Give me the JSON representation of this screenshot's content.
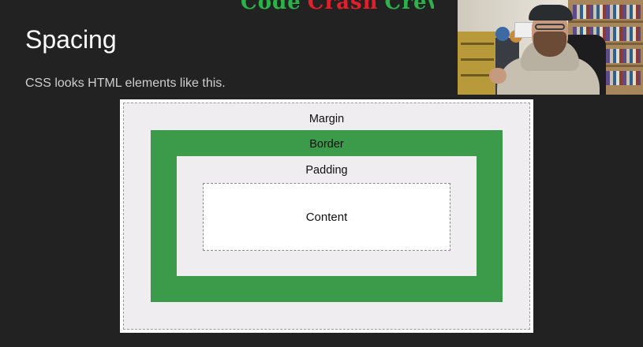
{
  "logo": {
    "words": [
      "Code",
      "Crash",
      "Crew"
    ]
  },
  "slide": {
    "title": "Spacing",
    "subtitle": "CSS looks HTML elements like this."
  },
  "diagram": {
    "margin_label": "Margin",
    "border_label": "Border",
    "padding_label": "Padding",
    "content_label": "Content"
  },
  "colors": {
    "background": "#222222",
    "border_green": "#3c9a4b",
    "margin_gray": "#efedf0",
    "content_white": "#ffffff",
    "logo_green": "#2bb34a",
    "logo_red": "#e21f2a"
  }
}
